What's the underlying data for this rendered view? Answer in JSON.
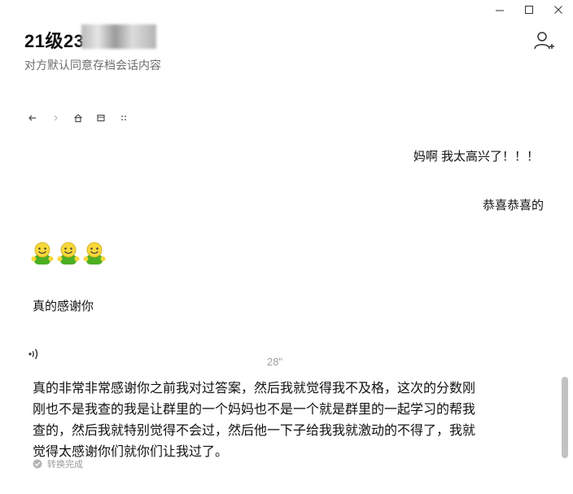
{
  "chat": {
    "title": "21级23",
    "subtitle": "对方默认同意存档会话内容"
  },
  "window_controls": {
    "minimize_icon": "minimize-icon",
    "maximize_icon": "maximize-icon",
    "close_icon": "close-icon"
  },
  "header_actions": {
    "add_member_icon": "add-person-icon"
  },
  "nav_bar": {
    "icons": [
      "arrow-left-icon",
      "arrow-right-icon",
      "home-icon",
      "window-icon",
      "more-dots-icon"
    ]
  },
  "messages": [
    {
      "side": "right",
      "text": "妈啊 我太高兴了！！！"
    },
    {
      "side": "right",
      "text": "恭喜恭喜的"
    },
    {
      "side": "left",
      "type": "emoji",
      "count": 3,
      "emoji_icon": "smiley-emoji-icon"
    },
    {
      "side": "left",
      "text": "真的感谢你"
    },
    {
      "side": "left",
      "type": "voice",
      "duration": "28\"",
      "voice_icon": "voice-wave-icon",
      "transcript": "真的非常非常感谢你之前我对过答案，然后我就觉得我不及格，这次的分数刚刚也不是我查的我是让群里的一个妈妈也不是一个就是群里的一起学习的帮我查的，然后我就特别觉得不会过，然后他一下子给我我就激动的不得了，我就觉得太感谢你们就你们让我过了。",
      "status_text": "转换完成",
      "status_icon": "check-circle-icon"
    }
  ],
  "colors": {
    "text": "#111111",
    "subtitle": "#6d6d6d",
    "muted": "#9a9a9a",
    "emoji_green": "#4caf24",
    "emoji_yellow": "#f7d83a",
    "scrollbar": "#c2c2c2"
  }
}
